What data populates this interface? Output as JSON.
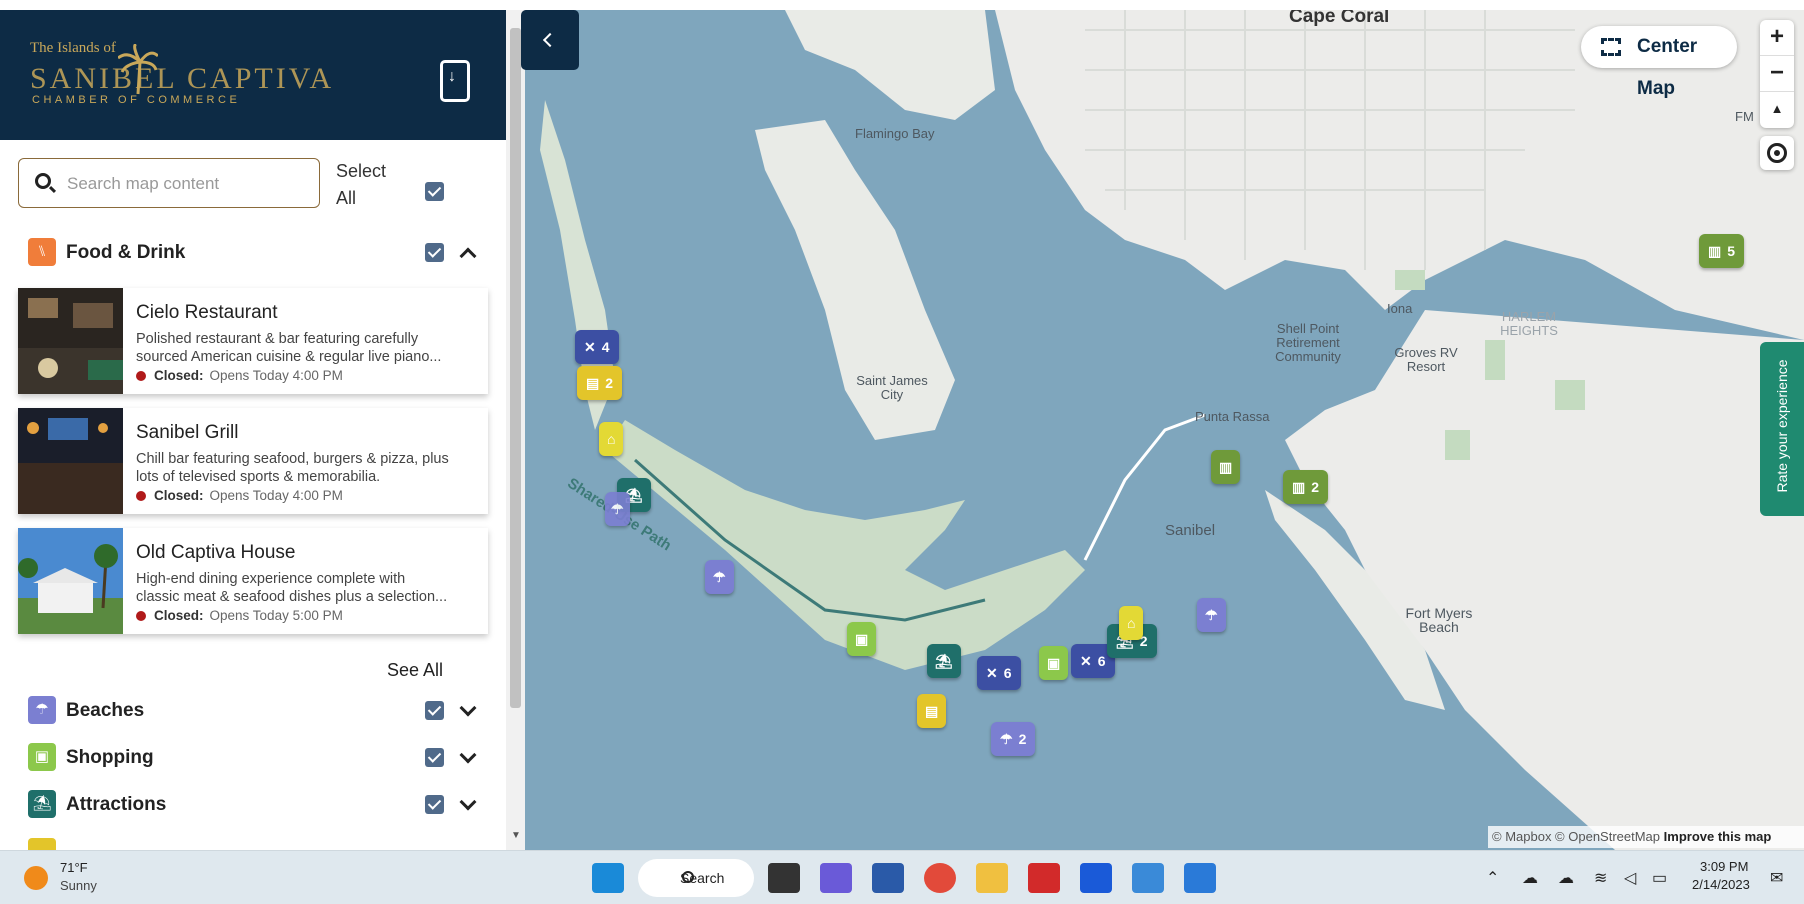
{
  "brand": {
    "line1": "The Islands of",
    "line2": "SANIBEL  CAPTIVA",
    "line3": "CHAMBER OF COMMERCE"
  },
  "search": {
    "placeholder": "Search map content",
    "value": ""
  },
  "select_all": {
    "label": "Select All",
    "checked": true
  },
  "categories": [
    {
      "label": "Food & Drink",
      "icon": "utensils-icon",
      "color": "#f07d3a",
      "expanded": true,
      "checked": true
    },
    {
      "label": "Beaches",
      "icon": "beach-umbrella-icon",
      "color": "#7b7fd1",
      "expanded": false,
      "checked": true
    },
    {
      "label": "Shopping",
      "icon": "shopping-bag-icon",
      "color": "#8cc84b",
      "expanded": false,
      "checked": true
    },
    {
      "label": "Attractions",
      "icon": "attraction-icon",
      "color": "#1f6f6a",
      "expanded": false,
      "checked": true
    }
  ],
  "places": [
    {
      "title": "Cielo Restaurant",
      "desc1": "Polished restaurant & bar featuring carefully",
      "desc2": "sourced American cuisine & regular live piano...",
      "status": "Closed:",
      "hours": "Opens Today 4:00 PM"
    },
    {
      "title": "Sanibel Grill",
      "desc1": "Chill bar featuring seafood, burgers & pizza, plus",
      "desc2": "lots of televised sports & memorabilia.",
      "status": "Closed:",
      "hours": "Opens Today 4:00 PM"
    },
    {
      "title": "Old Captiva House",
      "desc1": "High-end dining experience complete with",
      "desc2": "classic meat & seafood dishes plus a selection...",
      "status": "Closed:",
      "hours": "Opens Today 5:00 PM"
    }
  ],
  "see_all": "See All",
  "map": {
    "center_button": "Center Map",
    "zoom_in": "+",
    "zoom_out": "−",
    "compass": "▲",
    "rate_tab": "Rate your experience",
    "attribution": "© Mapbox © OpenStreetMap",
    "improve": "Improve this map",
    "labels": [
      "Cape Coral",
      "Flamingo Bay",
      "Saint James City",
      "Shell Point Retirement Community",
      "Iona",
      "Groves RV Resort",
      "HARLEM HEIGHTS",
      "Punta Rassa",
      "Sanibel",
      "Fort Myers Beach",
      "Shared-Use Path",
      "FM"
    ],
    "markers": [
      {
        "icon": "utensils-icon",
        "count": "4",
        "color": "#3c4fa3"
      },
      {
        "icon": "lodging-icon",
        "count": "2",
        "color": "#e3c52a"
      },
      {
        "icon": "home-icon",
        "count": "",
        "color": "#e3d935"
      },
      {
        "icon": "attraction-icon",
        "count": "",
        "color": "#1f6f6a"
      },
      {
        "icon": "beach-umbrella-icon",
        "count": "",
        "color": "#7b7fd1"
      },
      {
        "icon": "beach-umbrella-icon",
        "count": "",
        "color": "#7b7fd1"
      },
      {
        "icon": "shopping-bag-icon",
        "count": "",
        "color": "#8cc84b"
      },
      {
        "icon": "attraction-icon",
        "count": "",
        "color": "#1f6f6a"
      },
      {
        "icon": "utensils-icon",
        "count": "6",
        "color": "#3c4fa3"
      },
      {
        "icon": "lodging-icon",
        "count": "",
        "color": "#e3c52a"
      },
      {
        "icon": "shopping-bag-icon",
        "count": "",
        "color": "#8cc84b"
      },
      {
        "icon": "utensils-icon",
        "count": "6",
        "color": "#3c4fa3"
      },
      {
        "icon": "attraction-icon",
        "count": "2",
        "color": "#1f6f6a"
      },
      {
        "icon": "home-icon",
        "count": "",
        "color": "#e3d935"
      },
      {
        "icon": "beach-umbrella-icon",
        "count": "2",
        "color": "#7b7fd1"
      },
      {
        "icon": "beach-umbrella-icon",
        "count": "",
        "color": "#7b7fd1"
      },
      {
        "icon": "building-icon",
        "count": "",
        "color": "#6f9a3a"
      },
      {
        "icon": "building-icon",
        "count": "2",
        "color": "#6f9a3a"
      },
      {
        "icon": "building-icon",
        "count": "5",
        "color": "#6f9a3a"
      }
    ]
  },
  "taskbar": {
    "temperature": "71°F",
    "condition": "Sunny",
    "search_label": "Search",
    "time": "3:09 PM",
    "date": "2/14/2023"
  }
}
